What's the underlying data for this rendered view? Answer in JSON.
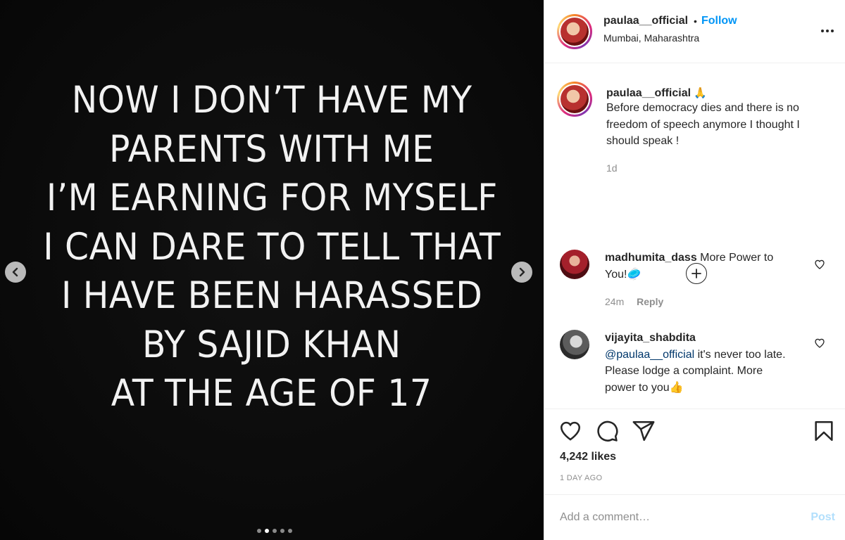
{
  "media": {
    "lines": [
      "NOW I DON’T HAVE MY",
      "PARENTS WITH ME",
      "I’M EARNING FOR MYSELF",
      "I CAN DARE TO TELL THAT",
      "I HAVE BEEN HARASSED",
      "BY SAJID KHAN",
      "AT THE AGE OF 17"
    ],
    "icons": {
      "prev": "chevron-left-icon",
      "next": "chevron-right-icon"
    },
    "dots_total": 5,
    "dots_active": 2
  },
  "header": {
    "username": "paulaa__official",
    "bullet": "•",
    "follow_label": "Follow",
    "location": "Mumbai, Maharashtra"
  },
  "caption": {
    "username": "paulaa__official",
    "emoji": "🙏",
    "text": "Before democracy dies and there is no freedom of speech anymore I thought I should speak !",
    "time": "1d"
  },
  "comments": [
    {
      "username": "madhumita_dass",
      "text": "More Power to You!",
      "emoji": "🥏",
      "time": "24m",
      "reply_label": "Reply"
    },
    {
      "username": "vijayita_shabdita",
      "mention": "@paulaa__official",
      "text": "it's never too late. Please lodge a complaint. More power to you",
      "emoji": "👍"
    }
  ],
  "actions": {
    "likes": "4,242 likes",
    "date": "1 DAY AGO",
    "icons": [
      "heart-icon",
      "comment-icon",
      "share-icon",
      "bookmark-icon"
    ]
  },
  "add_comment": {
    "placeholder": "Add a comment…",
    "post_label": "Post"
  },
  "colors": {
    "accent": "#0095f6",
    "mention": "#00376b",
    "post_disabled": "#b2dffc",
    "muted": "#8e8e8e",
    "text": "#262626"
  }
}
